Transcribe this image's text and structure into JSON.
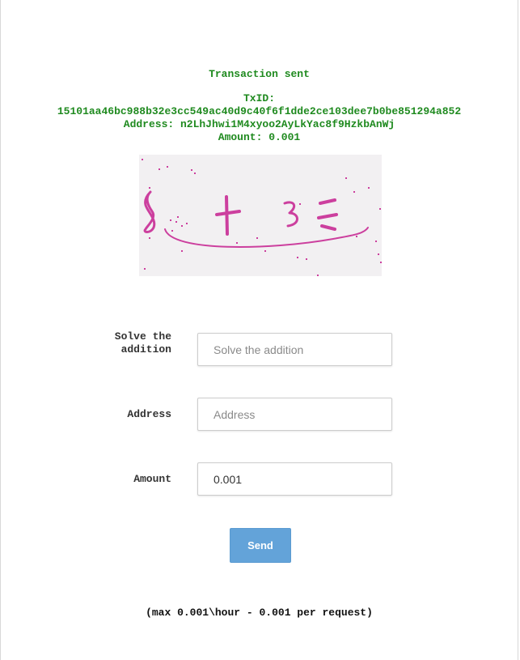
{
  "status": {
    "title": "Transaction sent",
    "txid_label": "TxID:",
    "txid": "15101aa46bc988b32e3cc549ac40d9c40f6f1dde2ce103dee7b0be851294a852",
    "address_line": "Address: n2LhJhwi1M4xyoo2AyLkYac8f9HzkbAnWj",
    "amount_line": "Amount: 0.001",
    "color": "#1f8a1f"
  },
  "captcha": {
    "text": "8 + 3 =",
    "ink_color": "#cc3f9e"
  },
  "form": {
    "solve": {
      "label": "Solve the addition",
      "placeholder": "Solve the addition",
      "value": ""
    },
    "address": {
      "label": "Address",
      "placeholder": "Address",
      "value": ""
    },
    "amount": {
      "label": "Amount",
      "placeholder": "",
      "value": "0.001"
    },
    "send_label": "Send"
  },
  "note": "(max 0.001\\hour - 0.001 per request)",
  "colors": {
    "button": "#63a3d9"
  }
}
